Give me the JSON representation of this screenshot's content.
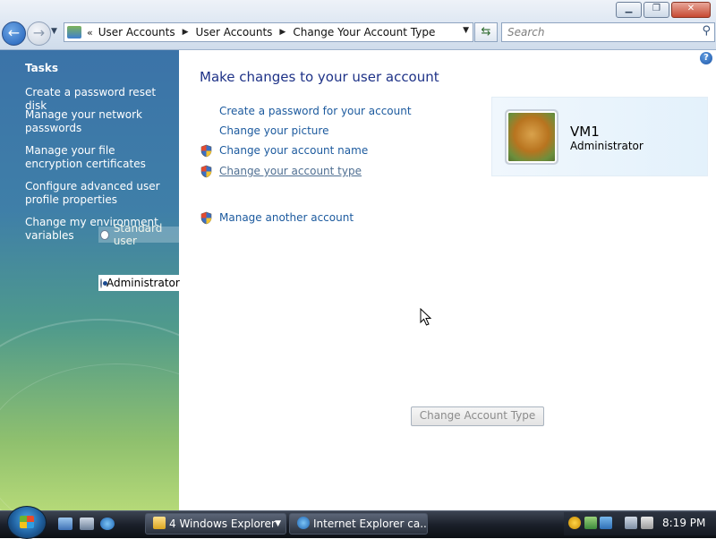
{
  "window": {
    "minimize_label": "▁",
    "maximize_label": "❐",
    "close_label": "✕"
  },
  "addressbar": {
    "chevron": "«",
    "crumbs": [
      "User Accounts",
      "User Accounts",
      "Change Your Account Type"
    ]
  },
  "search": {
    "placeholder": "Search"
  },
  "sidebar": {
    "heading": "Tasks",
    "links": [
      "Create a password reset disk",
      "Manage your network passwords",
      "Manage your file encryption certificates",
      "Configure advanced user profile properties",
      "Change my environment variables"
    ]
  },
  "account_type_options": [
    {
      "label": "Standard user",
      "selected": false
    },
    {
      "label": "Administrator",
      "selected": true
    }
  ],
  "main": {
    "title": "Make changes to your user account",
    "links": [
      "Create a password for your account",
      "Change your picture",
      "Change your account name",
      "Change your account type",
      "Manage another account"
    ],
    "change_button": "Change Account Type"
  },
  "user": {
    "name": "VM1",
    "role": "Administrator"
  },
  "help_label": "?",
  "taskbar": {
    "explorer_group": "4 Windows Explorer",
    "ie_window": "Internet Explorer ca...",
    "clock": "8:19 PM"
  },
  "colors": {
    "link": "#1c5a9e",
    "title": "#1e3287",
    "sidebar_top": "#3b73a8",
    "sidebar_bottom": "#b5d978"
  }
}
